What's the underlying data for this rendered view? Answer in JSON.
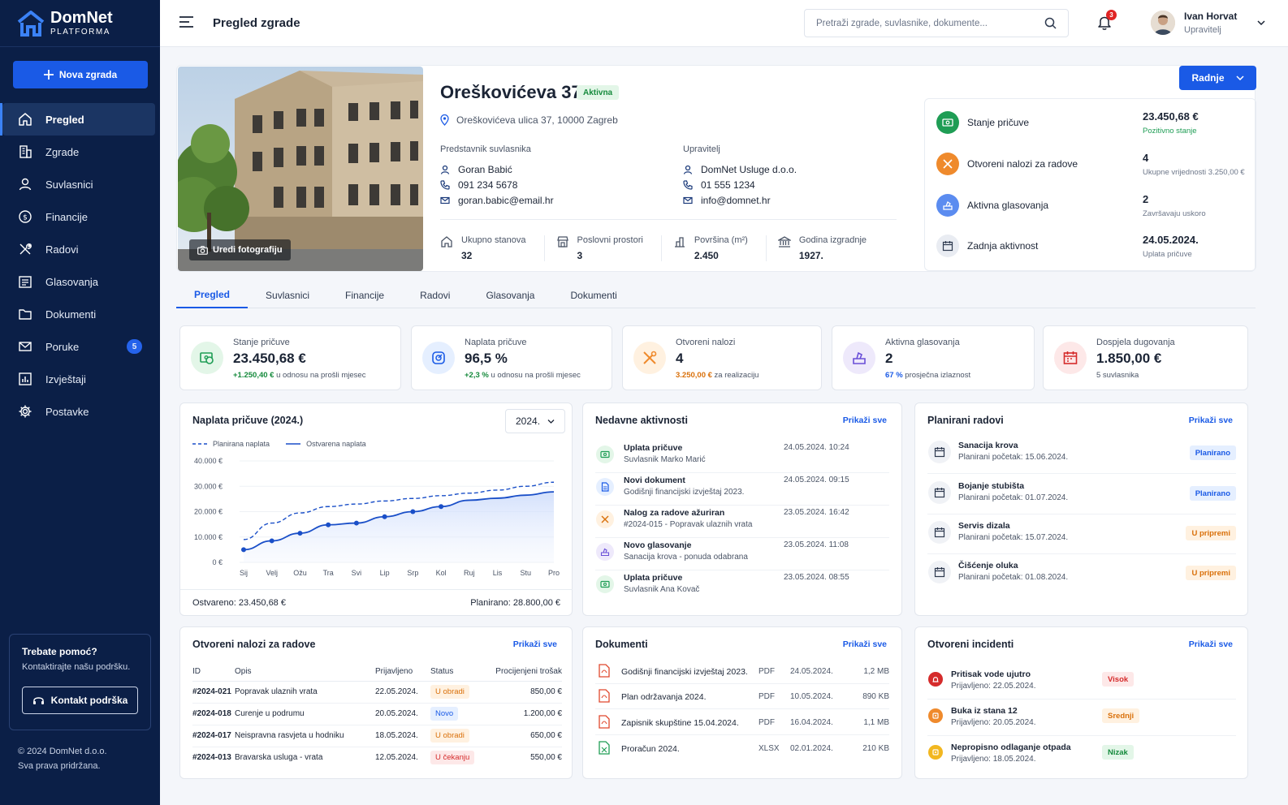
{
  "brand": {
    "name": "DomNet",
    "sub": "PLATFORMA"
  },
  "sidebar": {
    "new_label": "Nova zgrada",
    "items": [
      {
        "label": "Pregled",
        "icon": "home-icon"
      },
      {
        "label": "Zgrade",
        "icon": "building-icon"
      },
      {
        "label": "Suvlasnici",
        "icon": "user-icon"
      },
      {
        "label": "Financije",
        "icon": "dollar-icon"
      },
      {
        "label": "Radovi",
        "icon": "tools-icon"
      },
      {
        "label": "Glasovanja",
        "icon": "ballot-icon"
      },
      {
        "label": "Dokumenti",
        "icon": "folder-icon"
      },
      {
        "label": "Poruke",
        "icon": "mail-icon",
        "badge": "5"
      },
      {
        "label": "Izvještaji",
        "icon": "report-icon"
      },
      {
        "label": "Postavke",
        "icon": "gear-icon"
      }
    ],
    "help": {
      "title": "Trebate pomoć?",
      "text": "Kontaktirajte našu podršku.",
      "button": "Kontakt podrška"
    },
    "copyright": "© 2024 DomNet d.o.o.",
    "rights": "Sva prava pridržana."
  },
  "header": {
    "title": "Pregled zgrade",
    "search_placeholder": "Pretraži zgrade, suvlasnike, dokumente...",
    "notifications": "3",
    "user_name": "Ivan Horvat",
    "user_role": "Upravitelj"
  },
  "building": {
    "name": "Oreškovićeva 37",
    "status": "Aktivna",
    "address": "Oreškovićeva ulica 37, 10000 Zagreb",
    "edit_photo": "Uredi fotografiju",
    "representative": {
      "label": "Predstavnik suvlasnika",
      "name": "Goran Babić",
      "phone": "091 234 5678",
      "email": "goran.babic@email.hr"
    },
    "manager": {
      "label": "Upravitelj",
      "name": "DomNet Usluge d.o.o.",
      "phone": "01 555 1234",
      "email": "info@domnet.hr"
    },
    "stats": [
      {
        "label": "Ukupno stanova",
        "value": "32"
      },
      {
        "label": "Poslovni prostori",
        "value": "3"
      },
      {
        "label": "Površina (m²)",
        "value": "2.450"
      },
      {
        "label": "Godina izgradnje",
        "value": "1927."
      }
    ],
    "actions_label": "Radnje"
  },
  "summary": [
    {
      "label": "Stanje pričuve",
      "value": "23.450,68 €",
      "sub": "Pozitivno stanje",
      "color": "#1f9d55",
      "sub_color": "#1f9d55"
    },
    {
      "label": "Otvoreni nalozi za radove",
      "value": "4",
      "sub": "Ukupne vrijednosti 3.250,00 €",
      "color": "#ef8a2c",
      "sub_color": "#6c7689"
    },
    {
      "label": "Aktivna glasovanja",
      "value": "2",
      "sub": "Završavaju uskoro",
      "color": "#5b8cf0",
      "sub_color": "#6c7689"
    },
    {
      "label": "Zadnja aktivnost",
      "value": "24.05.2024.",
      "sub": "Uplata pričuve",
      "color": "#e9ecf2",
      "sub_color": "#6c7689"
    }
  ],
  "tabs": [
    "Pregled",
    "Suvlasnici",
    "Financije",
    "Radovi",
    "Glasovanja",
    "Dokumenti"
  ],
  "kpis": [
    {
      "label": "Stanje pričuve",
      "value": "23.450,68 €",
      "accent": "+1.250,40 €",
      "rest": " u odnosu na prošli mjesec",
      "accent_color": "#158a3c",
      "bg": "#e3f6e8"
    },
    {
      "label": "Naplata pričuve",
      "value": "96,5 %",
      "accent": "+2,3 %",
      "rest": " u odnosu na prošli mjesec",
      "accent_color": "#158a3c",
      "bg": "#e5efff"
    },
    {
      "label": "Otvoreni nalozi",
      "value": "4",
      "accent": "3.250,00 €",
      "rest": " za realizaciju",
      "accent_color": "#d9700a",
      "bg": "#fff1e0"
    },
    {
      "label": "Aktivna glasovanja",
      "value": "2",
      "accent": "67 %",
      "rest": " prosječna izlaznost",
      "accent_color": "#1a5ae6",
      "bg": "#eee9fb"
    },
    {
      "label": "Dospjela dugovanja",
      "value": "1.850,00 €",
      "accent": "",
      "rest": "5 suvlasnika",
      "accent_color": "#4a5466",
      "bg": "#fde8e8"
    }
  ],
  "chart": {
    "title": "Naplata pričuve (2024.)",
    "year": "2024.",
    "legend_planned": "Planirana naplata",
    "legend_actual": "Ostvarena naplata",
    "achieved_label": "Ostvareno:",
    "achieved_value": " 23.450,68 €",
    "planned_label": "Planirano:",
    "planned_value": " 28.800,00 €"
  },
  "chart_data": {
    "type": "line",
    "categories": [
      "Sij",
      "Velj",
      "Ožu",
      "Tra",
      "Svi",
      "Lip",
      "Srp",
      "Kol",
      "Ruj",
      "Lis",
      "Stu",
      "Pro"
    ],
    "y_ticks": [
      "0 €",
      "10.000 €",
      "20.000 €",
      "30.000 €",
      "40.000 €"
    ],
    "ylim": [
      0,
      40000
    ],
    "series": [
      {
        "name": "Planirana naplata",
        "style": "dashed",
        "values": [
          9000,
          15500,
          19500,
          22000,
          23000,
          24200,
          25200,
          26300,
          27300,
          28500,
          30000,
          31600
        ]
      },
      {
        "name": "Ostvarena naplata",
        "style": "solid",
        "values": [
          5000,
          8500,
          11500,
          14800,
          15500,
          18000,
          20000,
          22000,
          24500,
          25300,
          26500,
          27800
        ]
      }
    ],
    "marker_points": 8
  },
  "activities": {
    "title": "Nedavne aktivnosti",
    "more": "Prikaži sve",
    "items": [
      {
        "title": "Uplata pričuve",
        "sub": "Suvlasnik Marko Marić",
        "time": "24.05.2024. 10:24",
        "color": "#1f9d55",
        "bg": "#e3f6e8",
        "icon": "money-icon"
      },
      {
        "title": "Novi dokument",
        "sub": "Godišnji financijski izvještaj 2023.",
        "time": "24.05.2024. 09:15",
        "color": "#1a5ae6",
        "bg": "#e5efff",
        "icon": "document-icon"
      },
      {
        "title": "Nalog za radove ažuriran",
        "sub": "#2024-015 - Popravak ulaznih vrata",
        "time": "23.05.2024. 16:42",
        "color": "#d9700a",
        "bg": "#fff1e0",
        "icon": "tools-icon"
      },
      {
        "title": "Novo glasovanje",
        "sub": "Sanacija krova - ponuda odabrana",
        "time": "23.05.2024. 11:08",
        "color": "#6a4fd8",
        "bg": "#eee9fb",
        "icon": "ballot-icon"
      },
      {
        "title": "Uplata pričuve",
        "sub": "Suvlasnik Ana Kovač",
        "time": "23.05.2024. 08:55",
        "color": "#1f9d55",
        "bg": "#e3f6e8",
        "icon": "money-icon"
      }
    ]
  },
  "planned": {
    "title": "Planirani radovi",
    "more": "Prikaži sve",
    "items": [
      {
        "title": "Sanacija krova",
        "sub": "Planirani početak: 15.06.2024.",
        "status": "Planirano",
        "tone": "blue"
      },
      {
        "title": "Bojanje stubišta",
        "sub": "Planirani početak: 01.07.2024.",
        "status": "Planirano",
        "tone": "blue"
      },
      {
        "title": "Servis dizala",
        "sub": "Planirani početak: 15.07.2024.",
        "status": "U pripremi",
        "tone": "orange"
      },
      {
        "title": "Čišćenje oluka",
        "sub": "Planirani početak: 01.08.2024.",
        "status": "U pripremi",
        "tone": "orange"
      }
    ]
  },
  "orders": {
    "title": "Otvoreni nalozi za radove",
    "more": "Prikaži sve",
    "columns": [
      "ID",
      "Opis",
      "Prijavljeno",
      "Status",
      "Procijenjeni trošak"
    ],
    "rows": [
      {
        "id": "#2024-021",
        "desc": "Popravak ulaznih vrata",
        "date": "22.05.2024.",
        "status": "U obradi",
        "tone": "orange",
        "cost": "850,00 €"
      },
      {
        "id": "#2024-018",
        "desc": "Curenje u podrumu",
        "date": "20.05.2024.",
        "status": "Novo",
        "tone": "blue",
        "cost": "1.200,00 €"
      },
      {
        "id": "#2024-017",
        "desc": "Neispravna rasvjeta u hodniku",
        "date": "18.05.2024.",
        "status": "U obradi",
        "tone": "orange",
        "cost": "650,00 €"
      },
      {
        "id": "#2024-013",
        "desc": "Bravarska usluga - vrata",
        "date": "12.05.2024.",
        "status": "U čekanju",
        "tone": "red",
        "cost": "550,00 €"
      }
    ]
  },
  "documents": {
    "title": "Dokumenti",
    "more": "Prikaži sve",
    "items": [
      {
        "name": "Godišnji financijski izvještaj 2023.",
        "type": "PDF",
        "date": "24.05.2024.",
        "size": "1,2 MB",
        "color": "#e0482d"
      },
      {
        "name": "Plan održavanja 2024.",
        "type": "PDF",
        "date": "10.05.2024.",
        "size": "890 KB",
        "color": "#e0482d"
      },
      {
        "name": "Zapisnik skupštine 15.04.2024.",
        "type": "PDF",
        "date": "16.04.2024.",
        "size": "1,1 MB",
        "color": "#e0482d"
      },
      {
        "name": "Proračun 2024.",
        "type": "XLSX",
        "date": "02.01.2024.",
        "size": "210 KB",
        "color": "#1f9d55"
      }
    ]
  },
  "incidents": {
    "title": "Otvoreni incidenti",
    "more": "Prikaži sve",
    "items": [
      {
        "title": "Pritisak vode ujutro",
        "sub": "Prijavljeno: 22.05.2024.",
        "level": "Visok",
        "tone": "red",
        "color": "#d52b2b"
      },
      {
        "title": "Buka iz stana 12",
        "sub": "Prijavljeno: 20.05.2024.",
        "level": "Srednji",
        "tone": "orange",
        "color": "#ef8a2c"
      },
      {
        "title": "Nepropisno odlaganje otpada",
        "sub": "Prijavljeno: 18.05.2024.",
        "level": "Nizak",
        "tone": "green",
        "color": "#f2b720"
      }
    ]
  }
}
